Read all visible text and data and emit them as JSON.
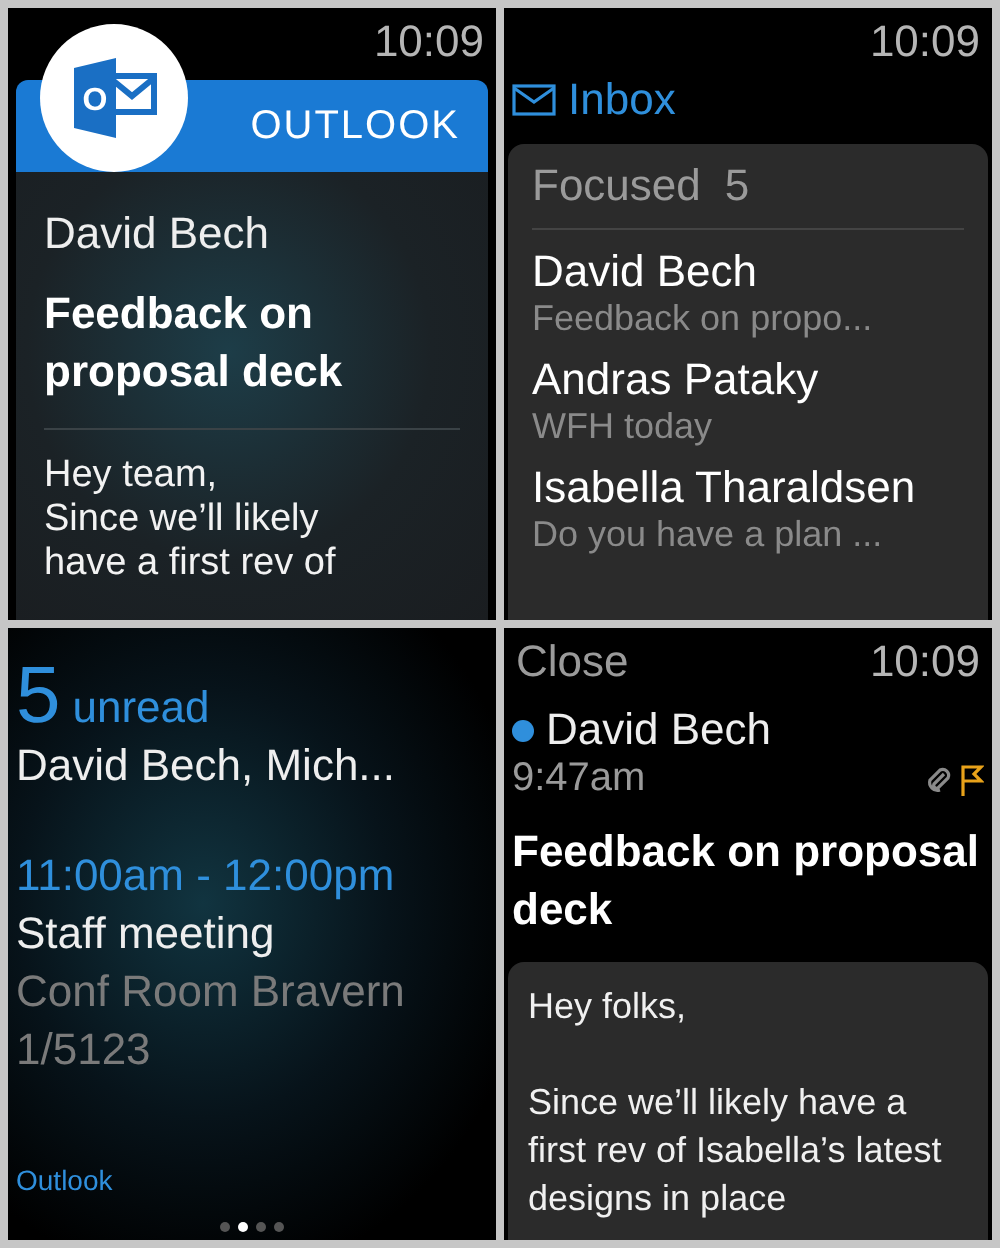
{
  "notification": {
    "time": "10:09",
    "logo_letter": "O",
    "app_name": "OUTLOOK",
    "sender": "David Bech",
    "subject": "Feedback on proposal deck",
    "body": "Hey team,\nSince we’ll likely\nhave a first rev of"
  },
  "inbox": {
    "time": "10:09",
    "title": "Inbox",
    "section": "Focused",
    "count": "5",
    "messages": [
      {
        "sender": "David Bech",
        "preview": "Feedback on propo..."
      },
      {
        "sender": "Andras Pataky",
        "preview": "WFH today"
      },
      {
        "sender": "Isabella Tharaldsen",
        "preview": "Do you have a plan ..."
      }
    ]
  },
  "glance": {
    "count": "5",
    "count_label": "unread",
    "senders": "David Bech, Mich...",
    "event_time": "11:00am - 12:00pm",
    "event_title": "Staff meeting",
    "event_location": "Conf Room Bravern 1/5123",
    "app_label": "Outlook",
    "pages": [
      {
        "selected": false
      },
      {
        "selected": true
      },
      {
        "selected": false
      },
      {
        "selected": false
      }
    ]
  },
  "message": {
    "close": "Close",
    "time": "10:09",
    "unread": true,
    "sender": "David Bech",
    "received": "9:47am",
    "has_attachment": true,
    "flagged": true,
    "subject": "Feedback on proposal deck",
    "body": "Hey folks,\n\nSince we’ll likely have a first rev of Isabella’s latest designs in place"
  }
}
